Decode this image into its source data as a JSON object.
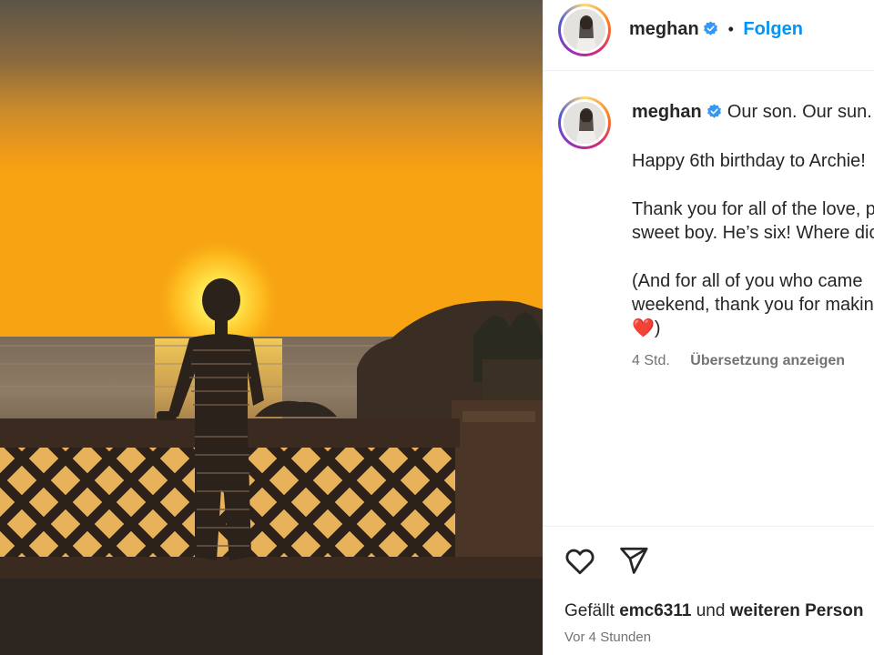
{
  "post": {
    "username": "meghan",
    "follow_label": "Folgen",
    "separator": "•",
    "caption_title": "Our son. Our sun.",
    "caption_lines": [
      "Happy 6th birthday to Archie!",
      "Thank you for all of the love, p",
      "sweet boy. He’s six! Where dic",
      "(And for all of you who came",
      "weekend, thank you for makin",
      ")"
    ],
    "heart_emoji": "❤️",
    "age": "4 Std.",
    "translate_label": "Übersetzung anzeigen",
    "likes_prefix": "Gefällt",
    "likes_user": "emc6311",
    "likes_and": "und",
    "likes_suffix": "weiteren Person",
    "timestamp": "Vor 4 Stunden"
  },
  "icons": {
    "verified": "verified-badge-icon",
    "like": "heart-outline-icon",
    "share": "paper-plane-icon"
  },
  "colors": {
    "follow_blue": "#0095f6",
    "verified_blue": "#3897f0",
    "heart_red": "#e0245e"
  }
}
